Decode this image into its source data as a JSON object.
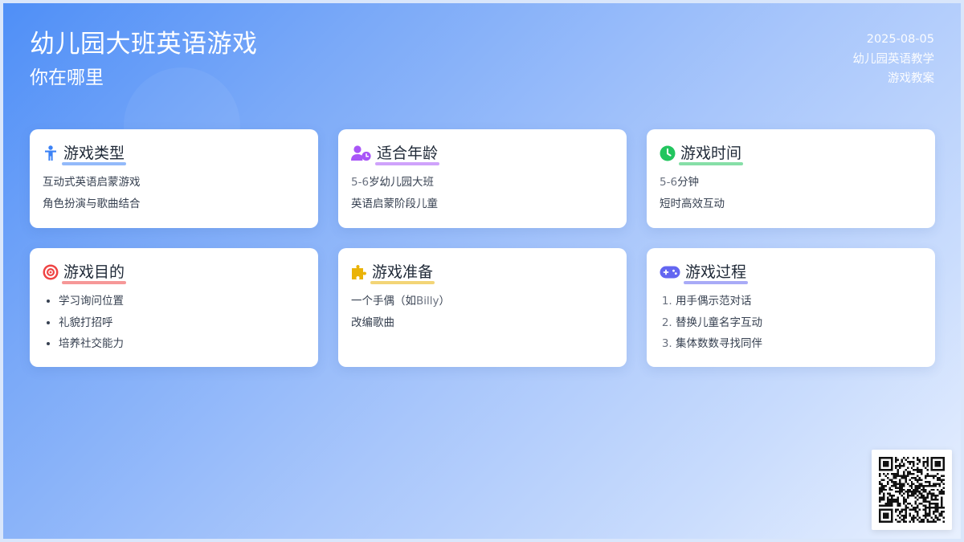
{
  "header": {
    "title": "幼儿园大班英语游戏",
    "subtitle": "你在哪里",
    "date": "2025-08-05",
    "category": "幼儿园英语教学",
    "doc_type": "游戏教案"
  },
  "cards": [
    {
      "icon": "child-icon",
      "color": "#3b82f6",
      "title": "游戏类型",
      "lines": [
        "互动式英语启蒙游戏",
        "角色扮演与歌曲结合"
      ]
    },
    {
      "icon": "user-clock-icon",
      "color": "#a855f7",
      "title": "适合年龄",
      "lines": [
        "5-6岁幼儿园大班",
        "英语启蒙阶段儿童"
      ]
    },
    {
      "icon": "clock-icon",
      "color": "#22c55e",
      "title": "游戏时间",
      "lines": [
        "5-6分钟",
        "短时高效互动"
      ]
    },
    {
      "icon": "target-icon",
      "color": "#ef4444",
      "title": "游戏目的",
      "items": [
        "学习询问位置",
        "礼貌打招呼",
        "培养社交能力"
      ]
    },
    {
      "icon": "puzzle-icon",
      "color": "#eab308",
      "title": "游戏准备",
      "lines": [
        "一个手偶（如Billy）",
        "改编歌曲"
      ]
    },
    {
      "icon": "gamepad-icon",
      "color": "#6366f1",
      "title": "游戏过程",
      "steps": [
        "用手偶示范对话",
        "替换儿童名字互动",
        "集体数数寻找同伴"
      ]
    }
  ]
}
